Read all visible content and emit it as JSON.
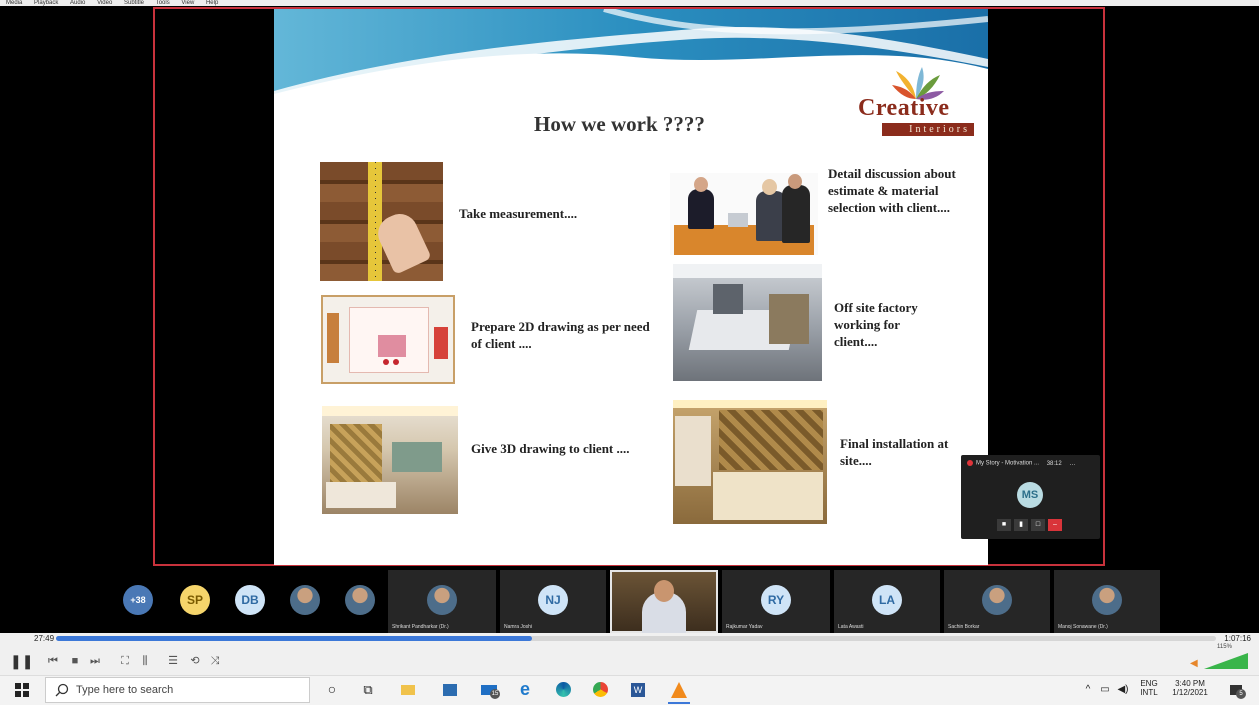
{
  "menu": [
    "Media",
    "Playback",
    "Audio",
    "Video",
    "Subtitle",
    "Tools",
    "View",
    "Help"
  ],
  "slide": {
    "title": "How we work ????",
    "logo": {
      "word": "Creative",
      "sub": "Interiors"
    },
    "steps": [
      {
        "text": "Take measurement...."
      },
      {
        "text": "Detail discussion about estimate & material selection with client...."
      },
      {
        "text": "Prepare 2D drawing as per need of client ...."
      },
      {
        "text": "Off site factory working for client...."
      },
      {
        "text": "Give 3D drawing to client ...."
      },
      {
        "text": "Final installation at site...."
      }
    ]
  },
  "mini_player": {
    "title": "My Story - Motivation ...",
    "time": "38:12",
    "initials": "MS"
  },
  "participants": {
    "overflow": "+38",
    "circles": [
      {
        "initials": "SP",
        "color": "#f5d56b",
        "text": "#7a5b00"
      },
      {
        "initials": "DB",
        "color": "#cfe4f7",
        "text": "#2f6aa3"
      }
    ],
    "tiles": [
      {
        "name": "Shrikant Pandharkar (Dr.)",
        "initials": ""
      },
      {
        "name": "Namra Joshi",
        "initials": "NJ"
      },
      {
        "name": "",
        "initials": ""
      },
      {
        "name": "Rajkumar Yadav",
        "initials": "RY"
      },
      {
        "name": "Lata Awasti",
        "initials": "LA"
      },
      {
        "name": "Sachin Borkar",
        "initials": ""
      },
      {
        "name": "Manoj Sonawane (Dr.)",
        "initials": ""
      }
    ]
  },
  "player": {
    "elapsed": "27:49",
    "total": "1:07:16",
    "progress": 0.41,
    "volume": "115%",
    "volume_level": 1.0
  },
  "taskbar": {
    "search_placeholder": "Type here to search",
    "badge": "15",
    "lang_top": "ENG",
    "lang_bottom": "INTL",
    "time": "3:40 PM",
    "date": "1/12/2021",
    "notification_count": "5"
  }
}
